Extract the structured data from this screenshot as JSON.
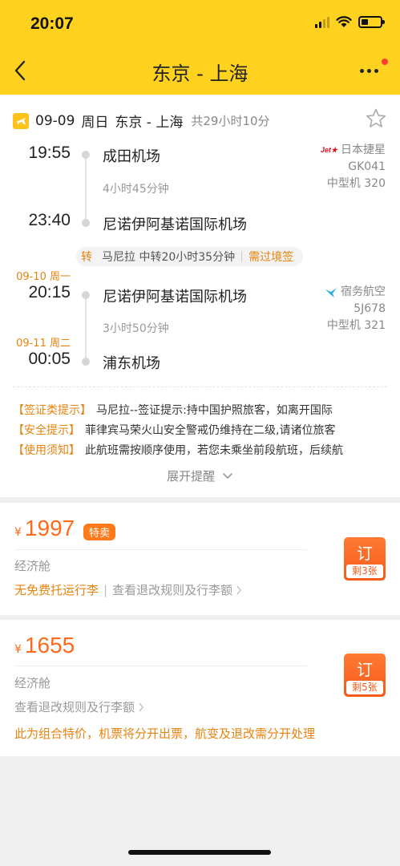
{
  "status_bar": {
    "time": "20:07"
  },
  "nav": {
    "title": "东京 - 上海"
  },
  "flight": {
    "date": "09-09",
    "weekday": "周日",
    "route": "东京 - 上海",
    "total_duration": "共29小时10分",
    "leg1": {
      "dep_time": "19:55",
      "dep_airport": "成田机场",
      "duration": "4小时45分钟",
      "arr_time": "23:40",
      "arr_airport": "尼诺伊阿基诺国际机场",
      "airline": "日本捷星",
      "flight_no": "GK041",
      "aircraft": "中型机 320",
      "logo_text": "Jet★"
    },
    "transfer": {
      "label": "转",
      "text": "马尼拉 中转20小时35分钟",
      "visa": "需过境签"
    },
    "leg2": {
      "dep_date": "09-10 周一",
      "dep_time": "20:15",
      "dep_airport": "尼诺伊阿基诺国际机场",
      "duration": "3小时50分钟",
      "arr_date": "09-11 周二",
      "arr_time": "00:05",
      "arr_airport": "浦东机场",
      "airline": "宿务航空",
      "flight_no": "5J678",
      "aircraft": "中型机 321"
    }
  },
  "notices": [
    {
      "tag": "【签证类提示】",
      "text": "马尼拉--签证提示:持中国护照旅客，如离开国际"
    },
    {
      "tag": "【安全提示】",
      "text": "菲律宾马荣火山安全警戒仍维持在二级,请诸位旅客"
    },
    {
      "tag": "【使用须知】",
      "text": "此航班需按顺序使用，若您未乘坐前段航班，后续航"
    }
  ],
  "expand_label": "展开提醒",
  "fares": [
    {
      "currency": "¥",
      "price": "1997",
      "badge": "特卖",
      "cabin": "经济舱",
      "no_baggage": "无免费托运行李",
      "rules": "查看退改规则及行李额",
      "book": "订",
      "remaining": "剩3张"
    },
    {
      "currency": "¥",
      "price": "1655",
      "cabin": "经济舱",
      "rules": "查看退改规则及行李额",
      "note": "此为组合特价，机票将分开出票，航变及退改需分开处理",
      "book": "订",
      "remaining": "剩5张"
    }
  ],
  "colors": {
    "header": "#ffd21f",
    "accent": "#e8830f",
    "price": "#ff6a1a",
    "book_button": "#f55a1a"
  }
}
